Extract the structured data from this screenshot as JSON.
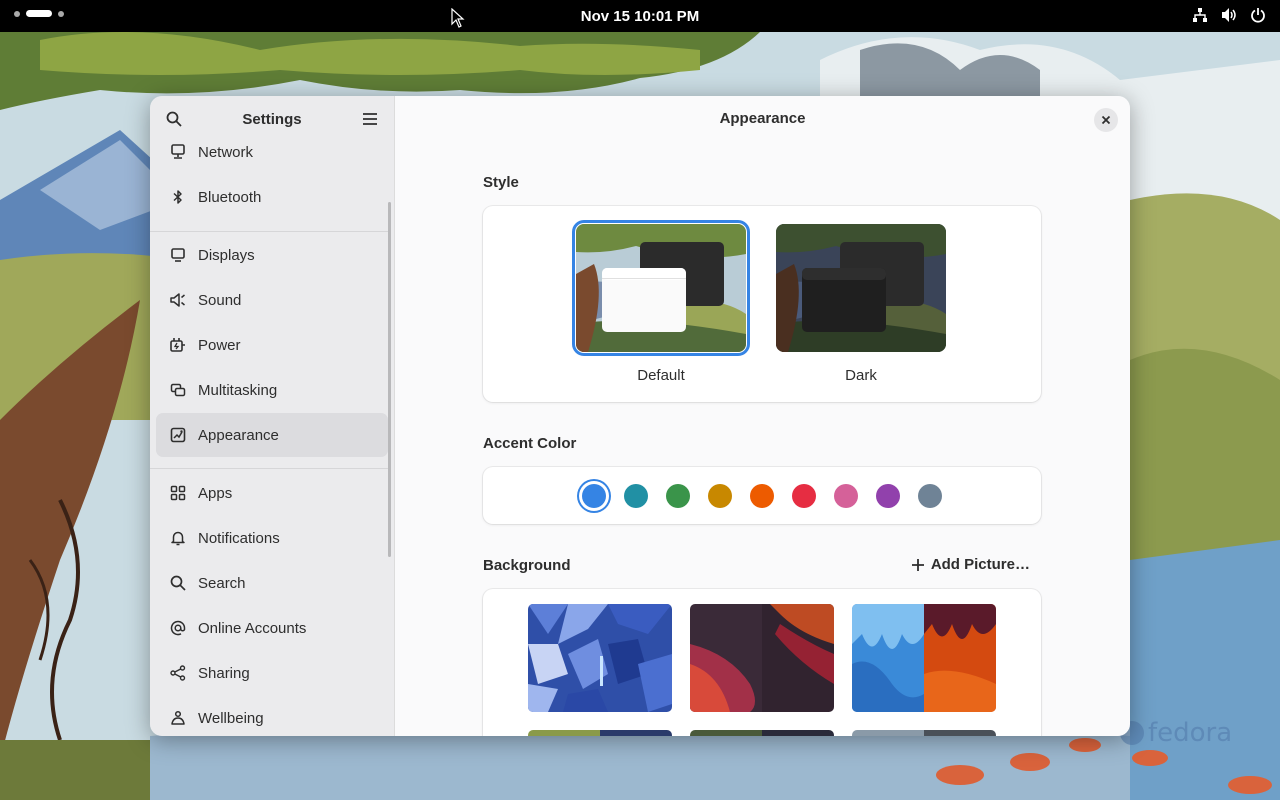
{
  "topbar": {
    "clock": "Nov 15  10:01 PM"
  },
  "sidebar": {
    "title": "Settings",
    "items": [
      {
        "label": "Network",
        "icon": "network-icon"
      },
      {
        "label": "Bluetooth",
        "icon": "bluetooth-icon"
      },
      {
        "label": "Displays",
        "icon": "display-icon"
      },
      {
        "label": "Sound",
        "icon": "speaker-icon"
      },
      {
        "label": "Power",
        "icon": "power-icon"
      },
      {
        "label": "Multitasking",
        "icon": "multitasking-icon"
      },
      {
        "label": "Appearance",
        "icon": "appearance-icon",
        "selected": true
      },
      {
        "label": "Apps",
        "icon": "apps-grid-icon"
      },
      {
        "label": "Notifications",
        "icon": "bell-icon"
      },
      {
        "label": "Search",
        "icon": "search-icon"
      },
      {
        "label": "Online Accounts",
        "icon": "at-sign-icon"
      },
      {
        "label": "Sharing",
        "icon": "share-icon"
      },
      {
        "label": "Wellbeing",
        "icon": "wellbeing-icon"
      }
    ]
  },
  "content": {
    "title": "Appearance",
    "style": {
      "label": "Style",
      "options": [
        {
          "label": "Default",
          "selected": true
        },
        {
          "label": "Dark",
          "selected": false
        }
      ]
    },
    "accent": {
      "label": "Accent Color",
      "colors": [
        "#3584e4",
        "#2190a4",
        "#3a944a",
        "#c88800",
        "#ed5b00",
        "#e62d42",
        "#d56199",
        "#9141ac",
        "#6f8396"
      ],
      "selected_index": 0
    },
    "background": {
      "label": "Background",
      "add_label": "Add Picture…"
    }
  },
  "colors": {
    "accent": "#3584e4",
    "sidebar_bg": "#ebebed",
    "content_bg": "#fafafb",
    "selected_item": "#dcdcdf"
  },
  "watermark": "fedora"
}
